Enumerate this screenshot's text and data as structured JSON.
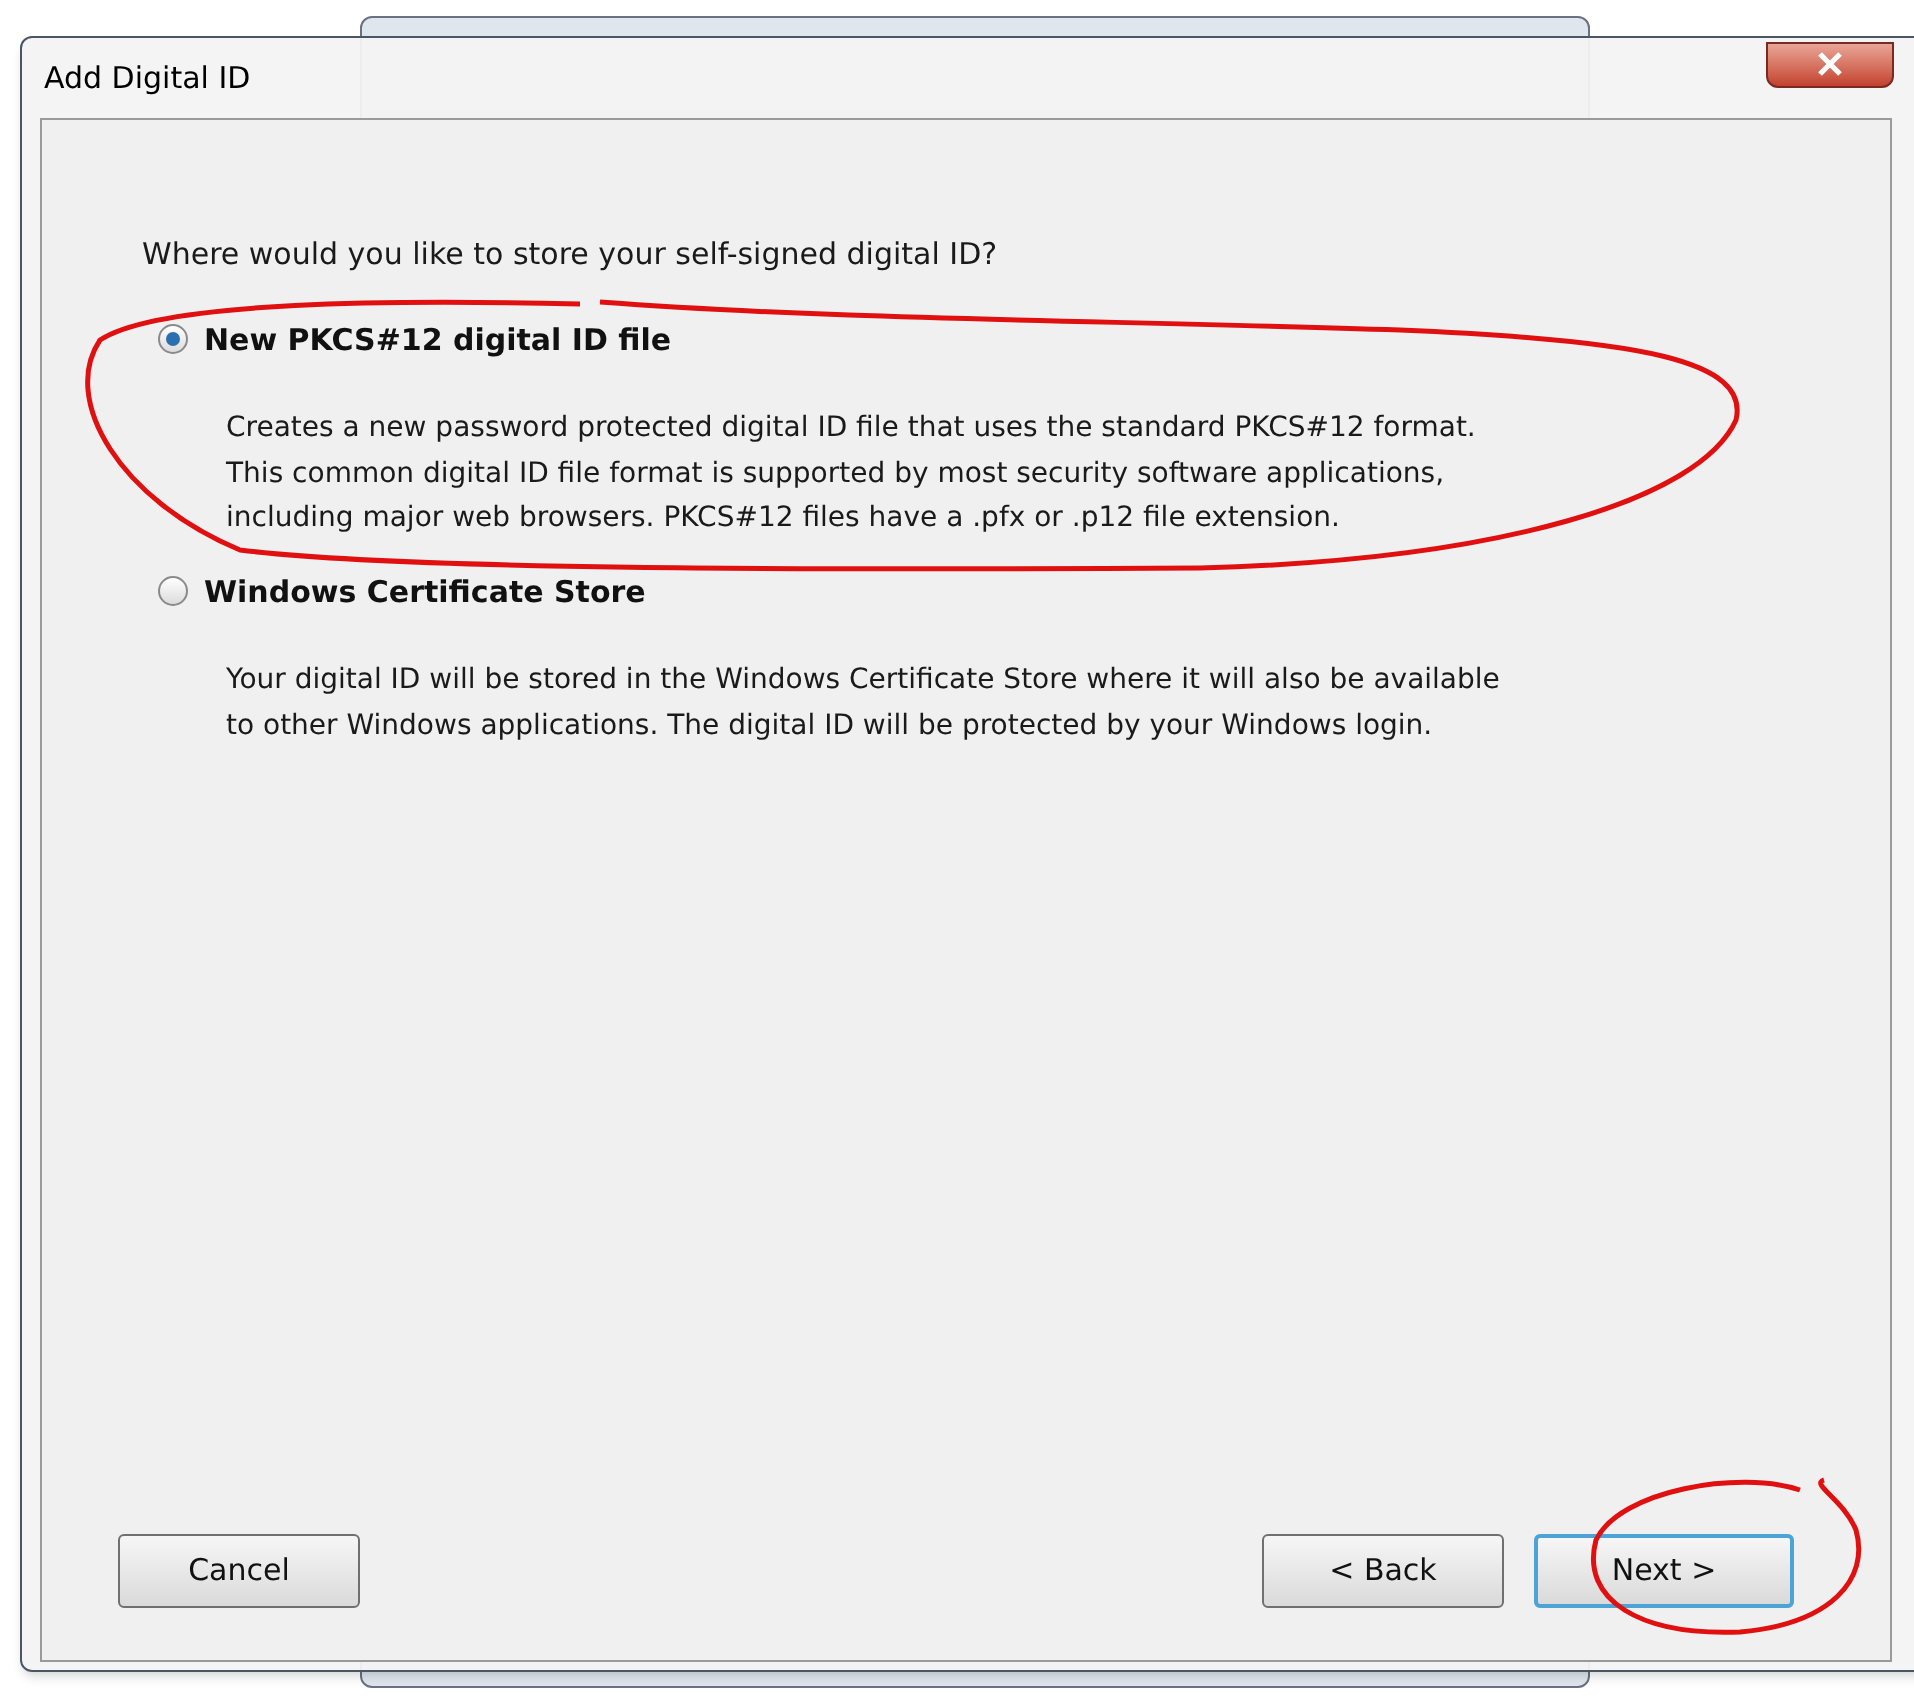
{
  "window": {
    "title": "Add Digital ID"
  },
  "question": "Where would you like to store your self-signed digital ID?",
  "options": [
    {
      "label": "New PKCS#12 digital ID file",
      "selected": true,
      "description": [
        "Creates a new password protected digital ID file that uses the standard PKCS#12 format.",
        "This common digital ID file format is supported by most security software applications,",
        "including major web browsers. PKCS#12 files have a .pfx or .p12 file extension."
      ]
    },
    {
      "label": "Windows Certificate Store",
      "selected": false,
      "description": [
        "Your digital ID will be stored in the Windows Certificate Store where it will also be available",
        "to other Windows applications. The digital ID will be protected by your Windows login."
      ]
    }
  ],
  "buttons": [
    {
      "label": "Cancel",
      "default": false
    },
    {
      "label": "< Back",
      "default": false
    },
    {
      "label": "Next >",
      "default": true
    }
  ]
}
